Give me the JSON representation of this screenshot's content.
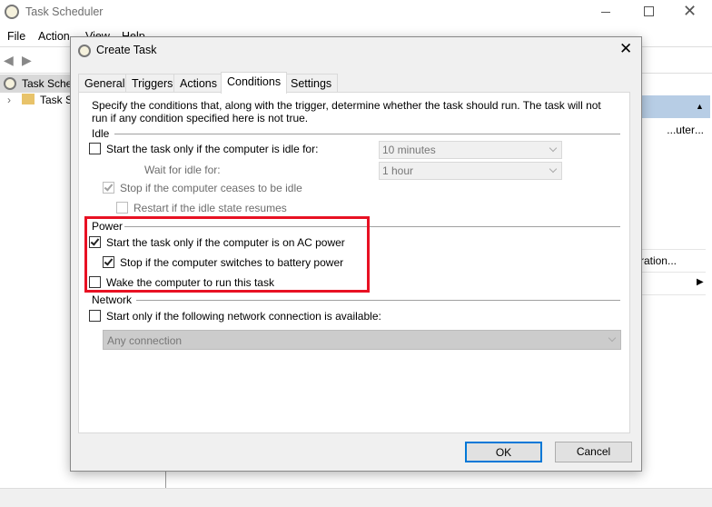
{
  "main_window": {
    "title": "Task Scheduler",
    "menu": [
      "File",
      "Action",
      "View",
      "Help"
    ],
    "tree": [
      "Task Scheduler (Local)",
      "Task Scheduler Library"
    ],
    "right_panel": {
      "item1": "...uter...",
      "item2": "...uration"
    }
  },
  "dialog": {
    "title": "Create Task",
    "tabs": [
      "General",
      "Triggers",
      "Actions",
      "Conditions",
      "Settings"
    ],
    "active_tab": "Conditions",
    "description": "Specify the conditions that, along with the trigger, determine whether the task should run.  The task will not run  if any condition specified here is not true.",
    "idle": {
      "label": "Idle",
      "start_idle": {
        "label": "Start the task only if the computer is idle for:",
        "checked": false,
        "value": "10 minutes"
      },
      "wait_label": "Wait for idle for:",
      "wait_value": "1 hour",
      "stop_idle": {
        "label": "Stop if the computer ceases to be idle",
        "checked": true,
        "disabled": true
      },
      "restart_idle": {
        "label": "Restart if the idle state resumes",
        "checked": false,
        "disabled": true
      }
    },
    "power": {
      "label": "Power",
      "ac_power": {
        "label": "Start the task only if the computer is on AC power",
        "checked": true
      },
      "battery": {
        "label": "Stop if the computer switches to battery power",
        "checked": true
      },
      "wake": {
        "label": "Wake the computer to run this task",
        "checked": false
      }
    },
    "network": {
      "label": "Network",
      "start_network": {
        "label": "Start only if the following network connection is available:",
        "checked": false
      },
      "connection": "Any connection"
    },
    "ok": "OK",
    "cancel": "Cancel"
  },
  "colors": {
    "highlight": "#e81123",
    "accent": "#0078d7"
  }
}
